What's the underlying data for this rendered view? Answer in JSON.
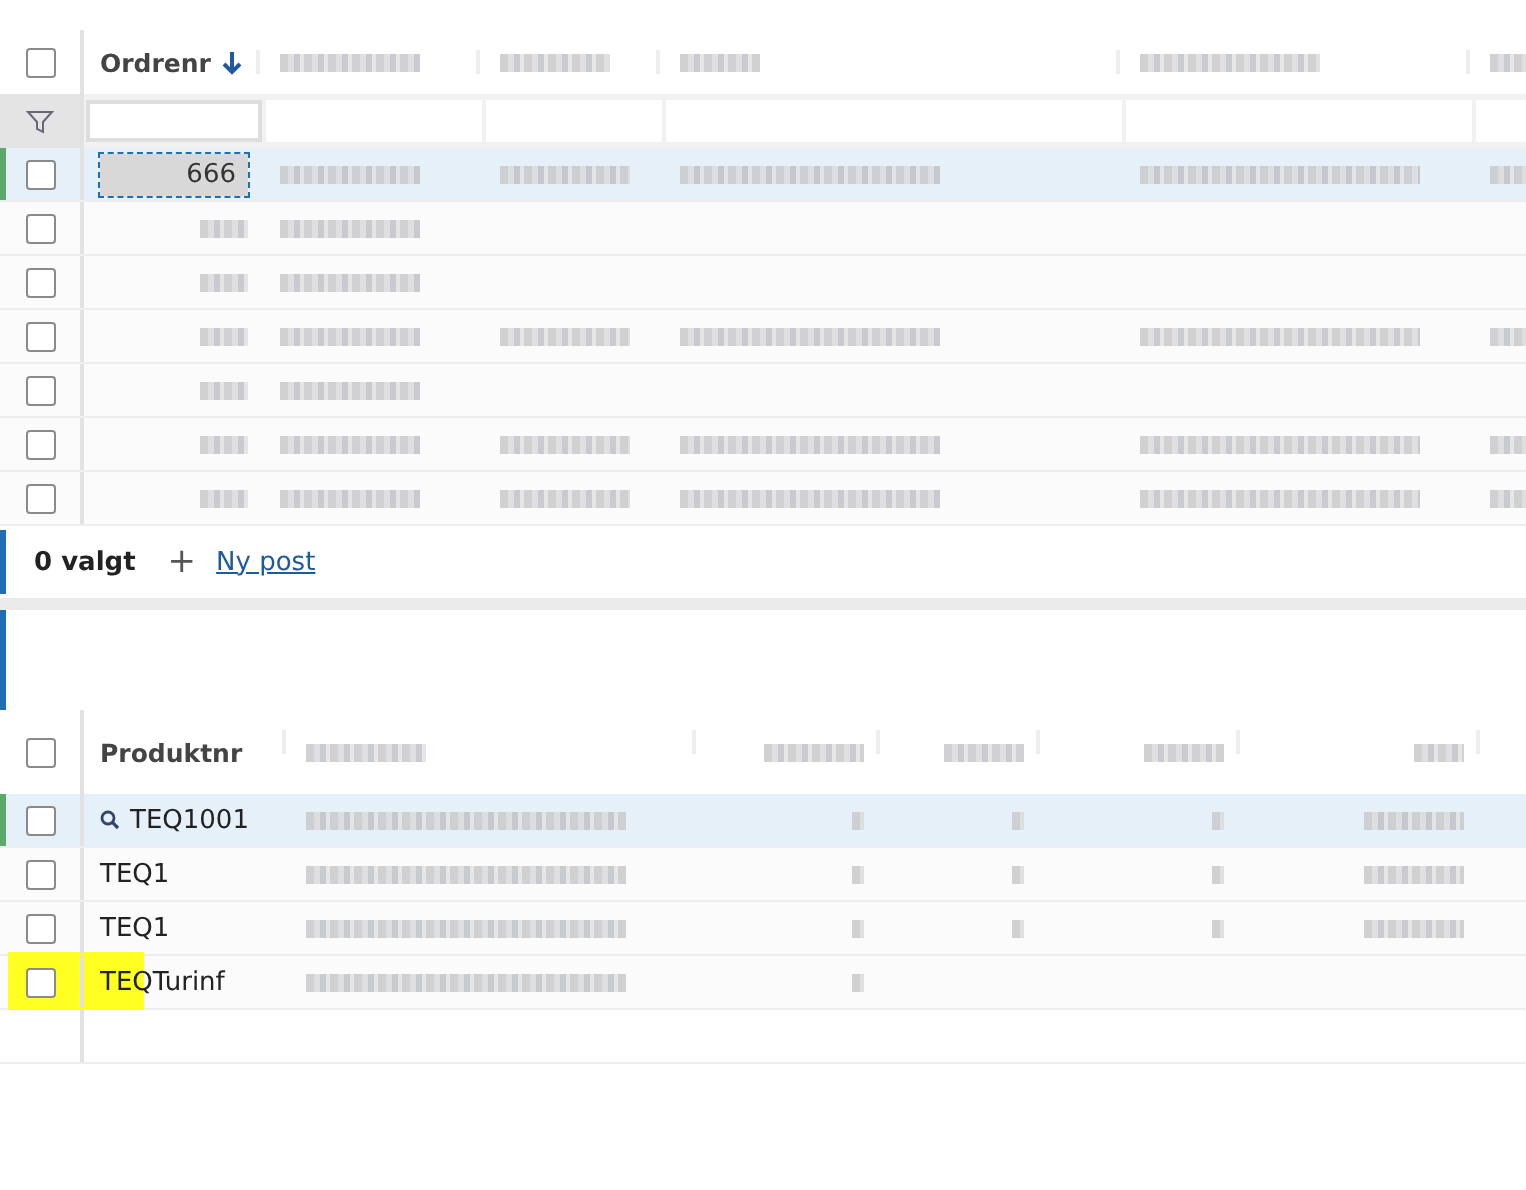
{
  "orders": {
    "all_checked": false,
    "columns": [
      {
        "kind": "text",
        "label": "Ordrenr",
        "sorted_descending": true
      },
      {
        "kind": "blurred"
      },
      {
        "kind": "blurred"
      },
      {
        "kind": "blurred"
      },
      {
        "kind": "blurred"
      },
      {
        "kind": "blurred"
      }
    ],
    "rows": [
      {
        "selected": true,
        "checked": false,
        "cells": [
          {
            "kind": "text",
            "text": "666",
            "focused": true
          },
          {
            "kind": "blurred"
          },
          {
            "kind": "blurred"
          },
          {
            "kind": "blurred"
          },
          {
            "kind": "blurred"
          },
          {
            "kind": "blurred"
          }
        ]
      },
      {
        "selected": false,
        "checked": false,
        "cells": [
          {
            "kind": "blurred"
          },
          {
            "kind": "blurred"
          },
          {
            "kind": "empty"
          },
          {
            "kind": "empty"
          },
          {
            "kind": "empty"
          },
          {
            "kind": "empty"
          }
        ]
      },
      {
        "selected": false,
        "checked": false,
        "cells": [
          {
            "kind": "blurred"
          },
          {
            "kind": "blurred"
          },
          {
            "kind": "empty"
          },
          {
            "kind": "empty"
          },
          {
            "kind": "empty"
          },
          {
            "kind": "empty"
          }
        ]
      },
      {
        "selected": false,
        "checked": false,
        "cells": [
          {
            "kind": "blurred"
          },
          {
            "kind": "blurred"
          },
          {
            "kind": "blurred"
          },
          {
            "kind": "blurred"
          },
          {
            "kind": "blurred"
          },
          {
            "kind": "blurred"
          }
        ]
      },
      {
        "selected": false,
        "checked": false,
        "cells": [
          {
            "kind": "blurred"
          },
          {
            "kind": "blurred"
          },
          {
            "kind": "empty"
          },
          {
            "kind": "empty"
          },
          {
            "kind": "empty"
          },
          {
            "kind": "empty"
          }
        ]
      },
      {
        "selected": false,
        "checked": false,
        "cells": [
          {
            "kind": "blurred"
          },
          {
            "kind": "blurred"
          },
          {
            "kind": "blurred"
          },
          {
            "kind": "blurred"
          },
          {
            "kind": "blurred"
          },
          {
            "kind": "blurred"
          }
        ]
      },
      {
        "selected": false,
        "checked": false,
        "cells": [
          {
            "kind": "blurred"
          },
          {
            "kind": "blurred"
          },
          {
            "kind": "blurred"
          },
          {
            "kind": "blurred"
          },
          {
            "kind": "blurred"
          },
          {
            "kind": "blurred"
          }
        ]
      }
    ],
    "selected_count": "0 valgt",
    "new_record_icon": "+",
    "new_record": "Ny post"
  },
  "products": {
    "all_checked": false,
    "columns": [
      {
        "kind": "text",
        "label": "Produktnr"
      },
      {
        "kind": "blurred"
      },
      {
        "kind": "blurred"
      },
      {
        "kind": "blurred"
      },
      {
        "kind": "blurred"
      },
      {
        "kind": "blurred"
      }
    ],
    "rows": [
      {
        "selected": true,
        "checked": false,
        "highlighted": false,
        "cells": [
          {
            "kind": "text",
            "text": "TEQ1001",
            "lookup": true
          },
          {
            "kind": "blurred"
          },
          {
            "kind": "blurred"
          },
          {
            "kind": "blurred"
          },
          {
            "kind": "blurred"
          },
          {
            "kind": "blurred"
          }
        ]
      },
      {
        "selected": false,
        "checked": false,
        "highlighted": false,
        "cells": [
          {
            "kind": "text",
            "text": "TEQ1"
          },
          {
            "kind": "blurred"
          },
          {
            "kind": "blurred"
          },
          {
            "kind": "blurred"
          },
          {
            "kind": "blurred"
          },
          {
            "kind": "blurred"
          }
        ]
      },
      {
        "selected": false,
        "checked": false,
        "highlighted": false,
        "cells": [
          {
            "kind": "text",
            "text": "TEQ1"
          },
          {
            "kind": "blurred"
          },
          {
            "kind": "blurred"
          },
          {
            "kind": "blurred"
          },
          {
            "kind": "blurred"
          },
          {
            "kind": "blurred"
          }
        ]
      },
      {
        "selected": false,
        "checked": false,
        "highlighted": true,
        "cells": [
          {
            "kind": "text",
            "text": "TEQTurinf"
          },
          {
            "kind": "blurred"
          },
          {
            "kind": "blurred"
          },
          {
            "kind": "empty"
          },
          {
            "kind": "empty"
          },
          {
            "kind": "empty"
          }
        ]
      }
    ]
  }
}
